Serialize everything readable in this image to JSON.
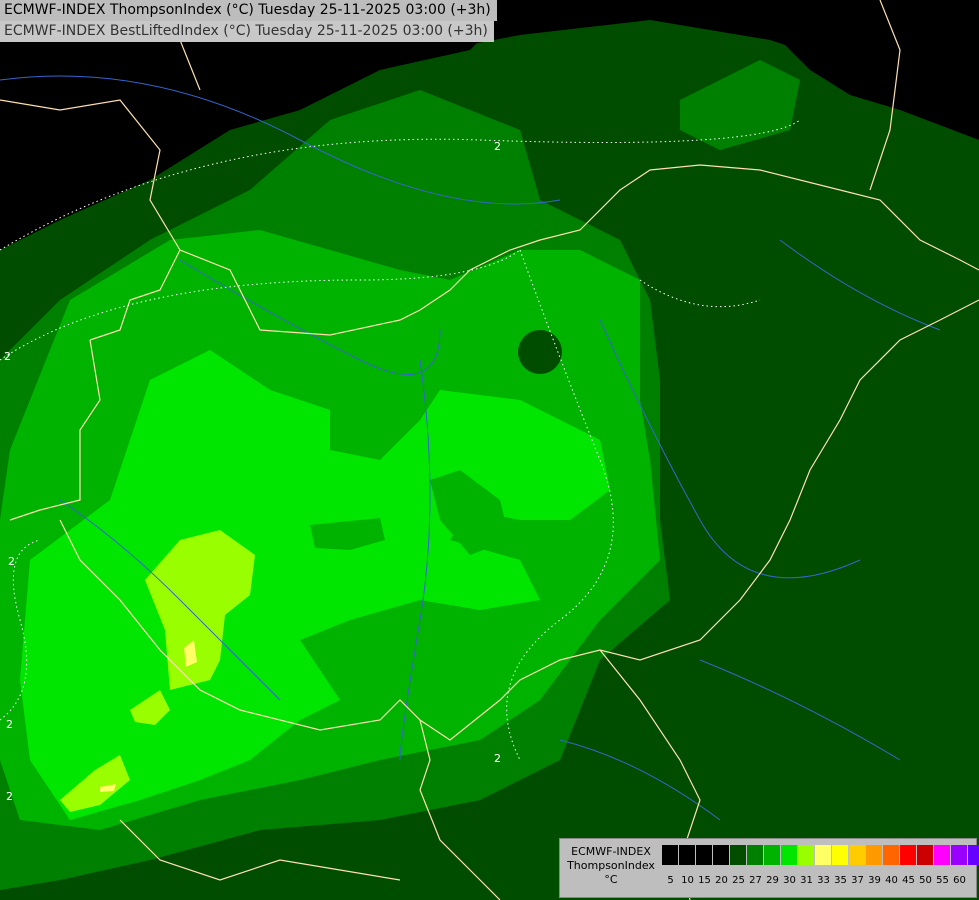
{
  "header": {
    "line1": "ECMWF-INDEX ThompsonIndex (°C) Tuesday 25-11-2025 03:00 (+3h)",
    "line2": "ECMWF-INDEX BestLiftedIndex (°C) Tuesday 25-11-2025 03:00 (+3h)"
  },
  "legend": {
    "title_line1": "ECMWF-INDEX",
    "title_line2": "ThompsonIndex",
    "unit": "°C",
    "ticks": [
      "5",
      "10",
      "15",
      "20",
      "25",
      "27",
      "29",
      "30",
      "31",
      "33",
      "35",
      "37",
      "39",
      "40",
      "45",
      "50",
      "55",
      "60"
    ],
    "colors": [
      "#000000",
      "#000000",
      "#000000",
      "#000000",
      "#004d00",
      "#008000",
      "#00b300",
      "#00e600",
      "#99ff00",
      "#ffff66",
      "#ffff00",
      "#ffcc00",
      "#ff9900",
      "#ff6600",
      "#ff0000",
      "#cc0000",
      "#ff00ff",
      "#9900ff",
      "#6600ff",
      "#0000ff"
    ]
  },
  "map": {
    "contour_labels": [
      "2",
      "2",
      "2",
      "2",
      "2",
      "2"
    ],
    "colors": {
      "background": "#000000",
      "level_25": "#004d00",
      "level_27": "#008000",
      "level_29": "#00b300",
      "level_30": "#00e600",
      "level_31": "#99ff00",
      "level_33": "#ffff66",
      "border": "#ffe0b0",
      "river": "#3366cc"
    }
  }
}
